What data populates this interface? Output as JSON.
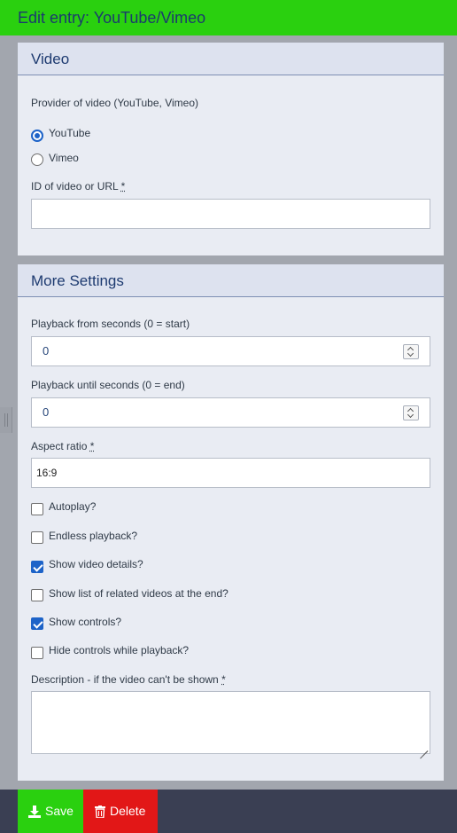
{
  "header": {
    "title": "Edit entry: YouTube/Vimeo"
  },
  "video": {
    "title": "Video",
    "provider_label": "Provider of video (YouTube, Vimeo)",
    "options": [
      "YouTube",
      "Vimeo"
    ],
    "selected": "YouTube",
    "id_label": "ID of video or URL",
    "required_mark": "*",
    "id_value": ""
  },
  "more": {
    "title": "More Settings",
    "from_label": "Playback from seconds (0 = start)",
    "from_value": "0",
    "until_label": "Playback until seconds (0 = end)",
    "until_value": "0",
    "aspect_label": "Aspect ratio",
    "aspect_value": "16:9",
    "checkboxes": [
      {
        "label": "Autoplay?",
        "checked": false
      },
      {
        "label": "Endless playback?",
        "checked": false
      },
      {
        "label": "Show video details?",
        "checked": true
      },
      {
        "label": "Show list of related videos at the end?",
        "checked": false
      },
      {
        "label": "Show controls?",
        "checked": true
      },
      {
        "label": "Hide controls while playback?",
        "checked": false
      }
    ],
    "description_label": "Description - if the video can't be shown",
    "required_mark": "*",
    "description_value": ""
  },
  "footer": {
    "save_label": "Save",
    "delete_label": "Delete"
  },
  "colors": {
    "accent_green": "#2ad00f",
    "danger_red": "#e21717",
    "selected_blue": "#1d63c8"
  }
}
